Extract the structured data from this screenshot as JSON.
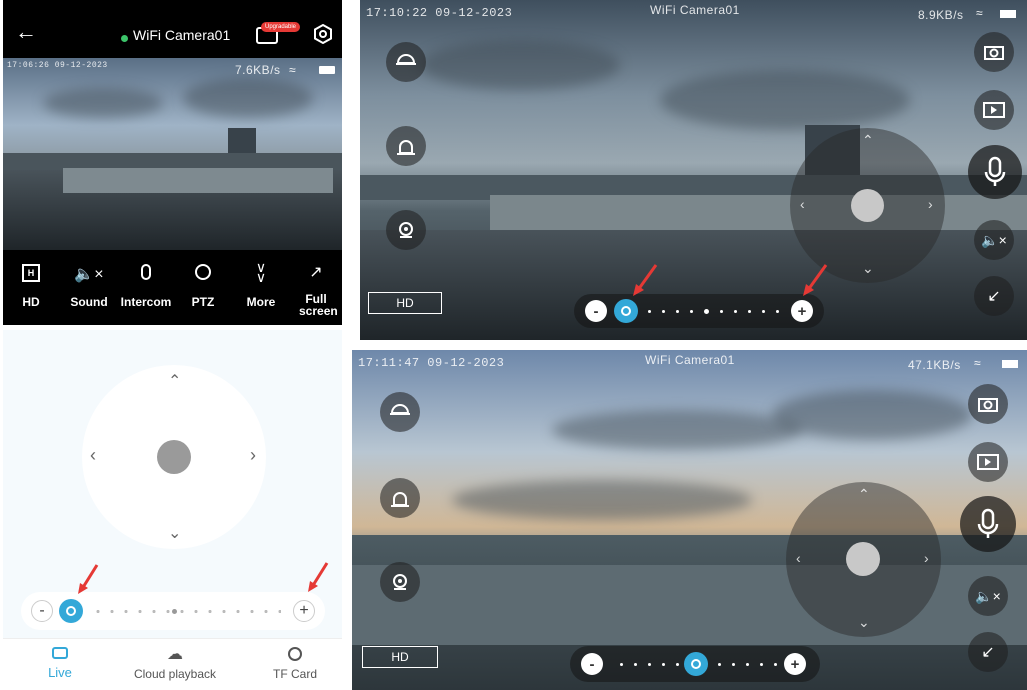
{
  "top_left": {
    "header": {
      "title": "WiFi Camera01",
      "badge": "Upgradable",
      "back_icon": "back-arrow-icon",
      "settings_icon": "gear-icon"
    },
    "osd": {
      "timestamp": "17:06:26 09-12-2023",
      "speed": "7.6KB/s"
    },
    "toolbar": [
      {
        "label": "HD",
        "icon": "hd-icon"
      },
      {
        "label": "Sound",
        "icon": "mute-icon"
      },
      {
        "label": "Intercom",
        "icon": "microphone-icon"
      },
      {
        "label": "PTZ",
        "icon": "ptz-camera-icon"
      },
      {
        "label": "More",
        "icon": "chevron-double-down-icon"
      },
      {
        "label": "Full screen",
        "icon": "fullscreen-icon"
      }
    ]
  },
  "top_right": {
    "osd": {
      "timestamp": "17:10:22 09-12-2023",
      "title": "WiFi Camera01",
      "speed": "8.9KB/s"
    },
    "hd_label": "HD",
    "zoom": {
      "minus": "-",
      "plus": "+"
    }
  },
  "bottom_left": {
    "zoom": {
      "minus": "-",
      "plus": "+"
    },
    "tabs": [
      {
        "label": "Live",
        "icon": "live-eye-icon",
        "active": true
      },
      {
        "label": "Cloud playback",
        "icon": "cloud-playback-icon",
        "active": false
      },
      {
        "label": "TF Card",
        "icon": "tf-card-icon",
        "active": false
      }
    ],
    "accent": "#33a8d8"
  },
  "bottom_right": {
    "osd": {
      "timestamp": "17:11:47 09-12-2023",
      "title": "WiFi Camera01",
      "speed": "47.1KB/s"
    },
    "hd_label": "HD",
    "zoom": {
      "minus": "-",
      "plus": "+"
    }
  }
}
